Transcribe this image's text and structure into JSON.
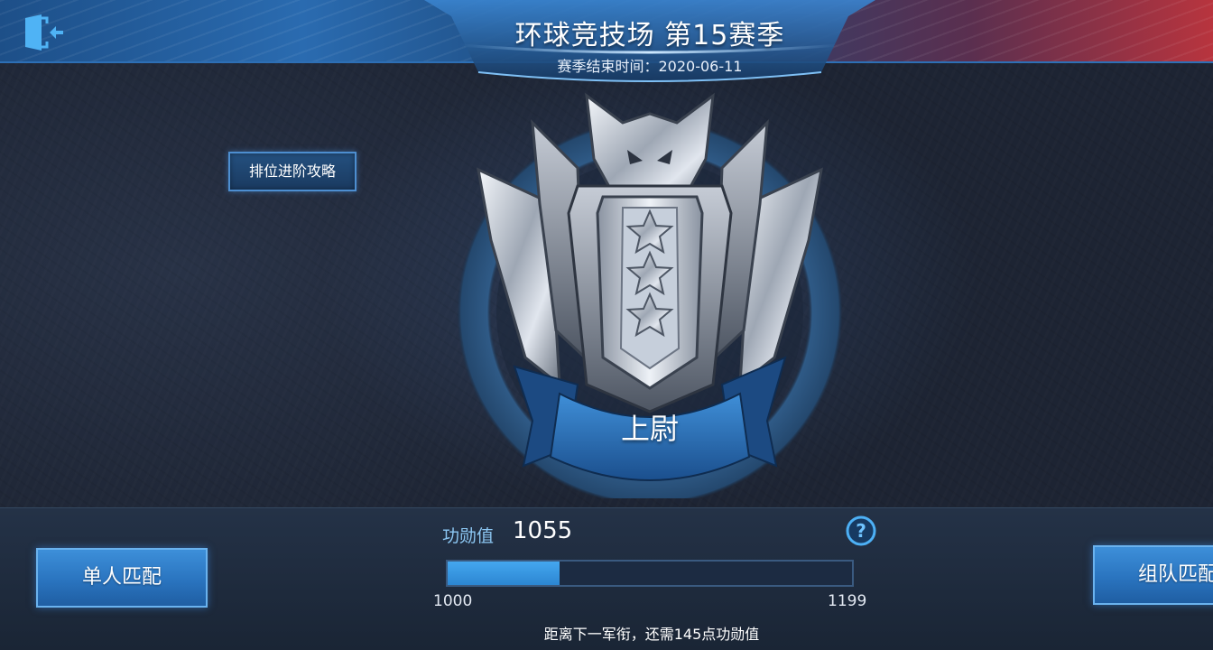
{
  "header": {
    "title": "环球竞技场  第15赛季",
    "season_end": "赛季结束时间：2020-06-11"
  },
  "left_panel": {
    "guide_button": "排位进阶攻略"
  },
  "rank": {
    "name": "上尉",
    "stars": 3
  },
  "merit": {
    "label": "功勋值",
    "value": "1055",
    "range_min": "1000",
    "range_max": "1199",
    "progress_fraction": 0.2764,
    "next_rank_hint": "距离下一军衔，还需145点功勋值"
  },
  "buttons": {
    "solo_match": "单人匹配",
    "team_match": "组队匹配"
  },
  "icons": {
    "exit": "exit-door-icon",
    "help": "question-mark-icon",
    "emblem": "wolf-rank-emblem-icon"
  },
  "colors": {
    "accent_blue": "#3a8fda",
    "progress_fill": "#3a9be6",
    "merit_label": "#8cc7f3",
    "top_bar_red": "#b8343e"
  }
}
